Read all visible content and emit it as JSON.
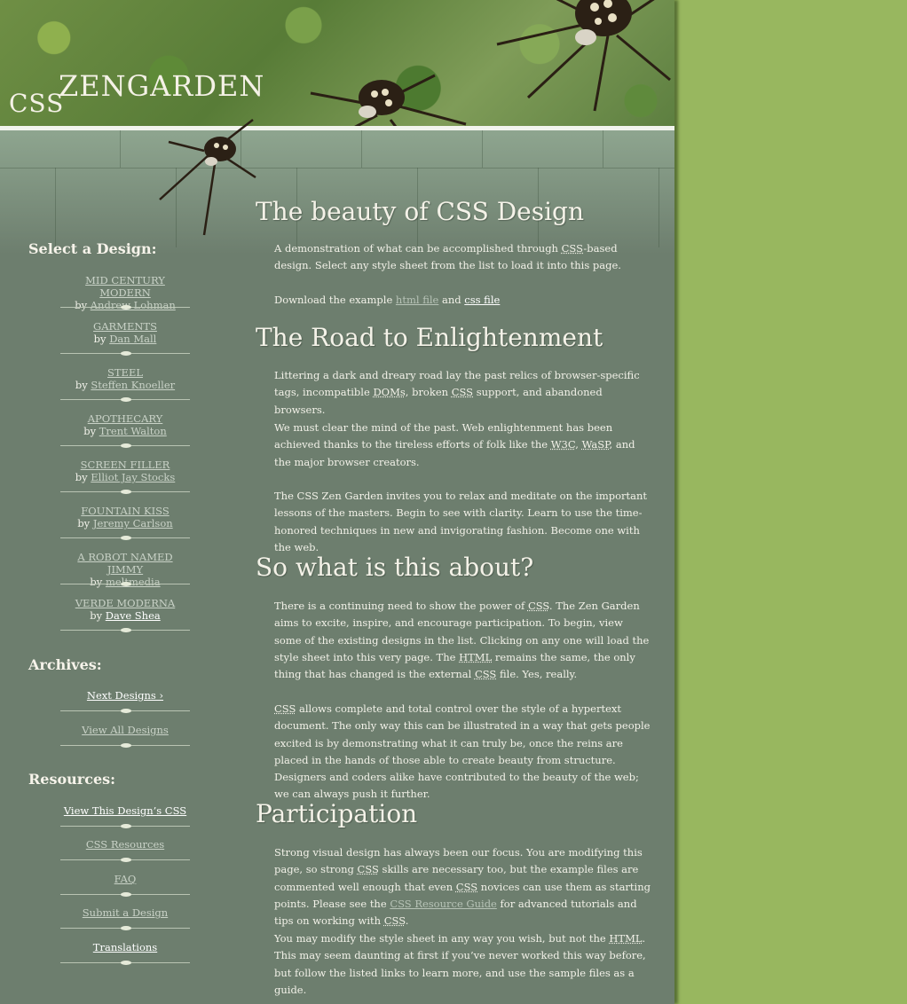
{
  "logo": {
    "css": "CSS",
    "zengarden": "ZENGARDEN"
  },
  "sidebar": {
    "select_heading": "Select a Design:",
    "by": "by",
    "designs": [
      {
        "name": "MID CENTURY MODERN",
        "author": "Andrew Lohman"
      },
      {
        "name": "GARMENTS",
        "author": "Dan Mall"
      },
      {
        "name": "STEEL",
        "author": "Steffen Knoeller"
      },
      {
        "name": "APOTHECARY",
        "author": "Trent Walton"
      },
      {
        "name": "SCREEN FILLER",
        "author": "Elliot Jay Stocks"
      },
      {
        "name": "FOUNTAIN KISS",
        "author": "Jeremy Carlson"
      },
      {
        "name": "A ROBOT NAMED JIMMY",
        "author": "meltmedia"
      },
      {
        "name": "VERDE MODERNA",
        "author": "Dave Shea"
      }
    ],
    "archives_heading": "Archives:",
    "archives": [
      "Next Designs ›",
      "View All Designs"
    ],
    "resources_heading": "Resources:",
    "resources": [
      "View This Design’s CSS",
      "CSS Resources",
      "FAQ",
      "Submit a Design",
      "Translations"
    ]
  },
  "main": {
    "h1": "The beauty of CSS Design",
    "intro_p1a": "A demonstration of what can be accomplished through ",
    "intro_p1b": "-based design. Select any style sheet from the list to load it into this page.",
    "download_pre": "Download the example ",
    "html_file": "html file",
    "and": " and ",
    "css_file": "css file",
    "h2": "The Road to Enlightenment",
    "road_p1a": "Littering a dark and dreary road lay the past relics of browser-specific tags, incompatible ",
    "doms": "DOMs",
    "road_p1b": ", broken ",
    "road_p1c": " support, and abandoned browsers.",
    "road_p2a": "We must clear the mind of the past. Web enlightenment has been achieved thanks to the tireless efforts of folk like the ",
    "w3c": "W3C",
    "comma": ", ",
    "wasp": "WaSP",
    "road_p2b": ", and the major browser creators.",
    "road_p3": "The CSS Zen Garden invites you to relax and meditate on the important lessons of the masters. Begin to see with clarity. Learn to use the time-honored techniques in new and invigorating fashion. Become one with the web.",
    "h3": "So what is this about?",
    "about_p1a": "There is a continuing need to show the power of ",
    "about_p1b": ". The Zen Garden aims to excite, inspire, and encourage participation. To begin, view some of the existing designs in the list. Clicking on any one will load the style sheet into this very page. The ",
    "html": "HTML",
    "about_p1c": " remains the same, the only thing that has changed is the external ",
    "about_p1d": " file. Yes, really.",
    "about_p2": " allows complete and total control over the style of a hypertext document. The only way this can be illustrated in a way that gets people excited is by demonstrating what it can truly be, once the reins are placed in the hands of those able to create beauty from structure. Designers and coders alike have contributed to the beauty of the web; we can always push it further.",
    "h4": "Participation",
    "part_p1a": "Strong visual design has always been our focus. You are modifying this page, so strong ",
    "part_p1b": " skills are necessary too, but the example files are commented well enough that even ",
    "part_p1c": " novices can use them as starting points. Please see the ",
    "css_resource_guide": "CSS Resource Guide",
    "part_p1d": " for advanced tutorials and tips on working with ",
    "period": ".",
    "part_p2a": "You may modify the style sheet in any way you wish, but not the ",
    "part_p2b": ". This may seem daunting at first if you’ve never worked this way before, but follow the listed links to learn more, and use the sample files as a guide.",
    "css": "CSS"
  }
}
